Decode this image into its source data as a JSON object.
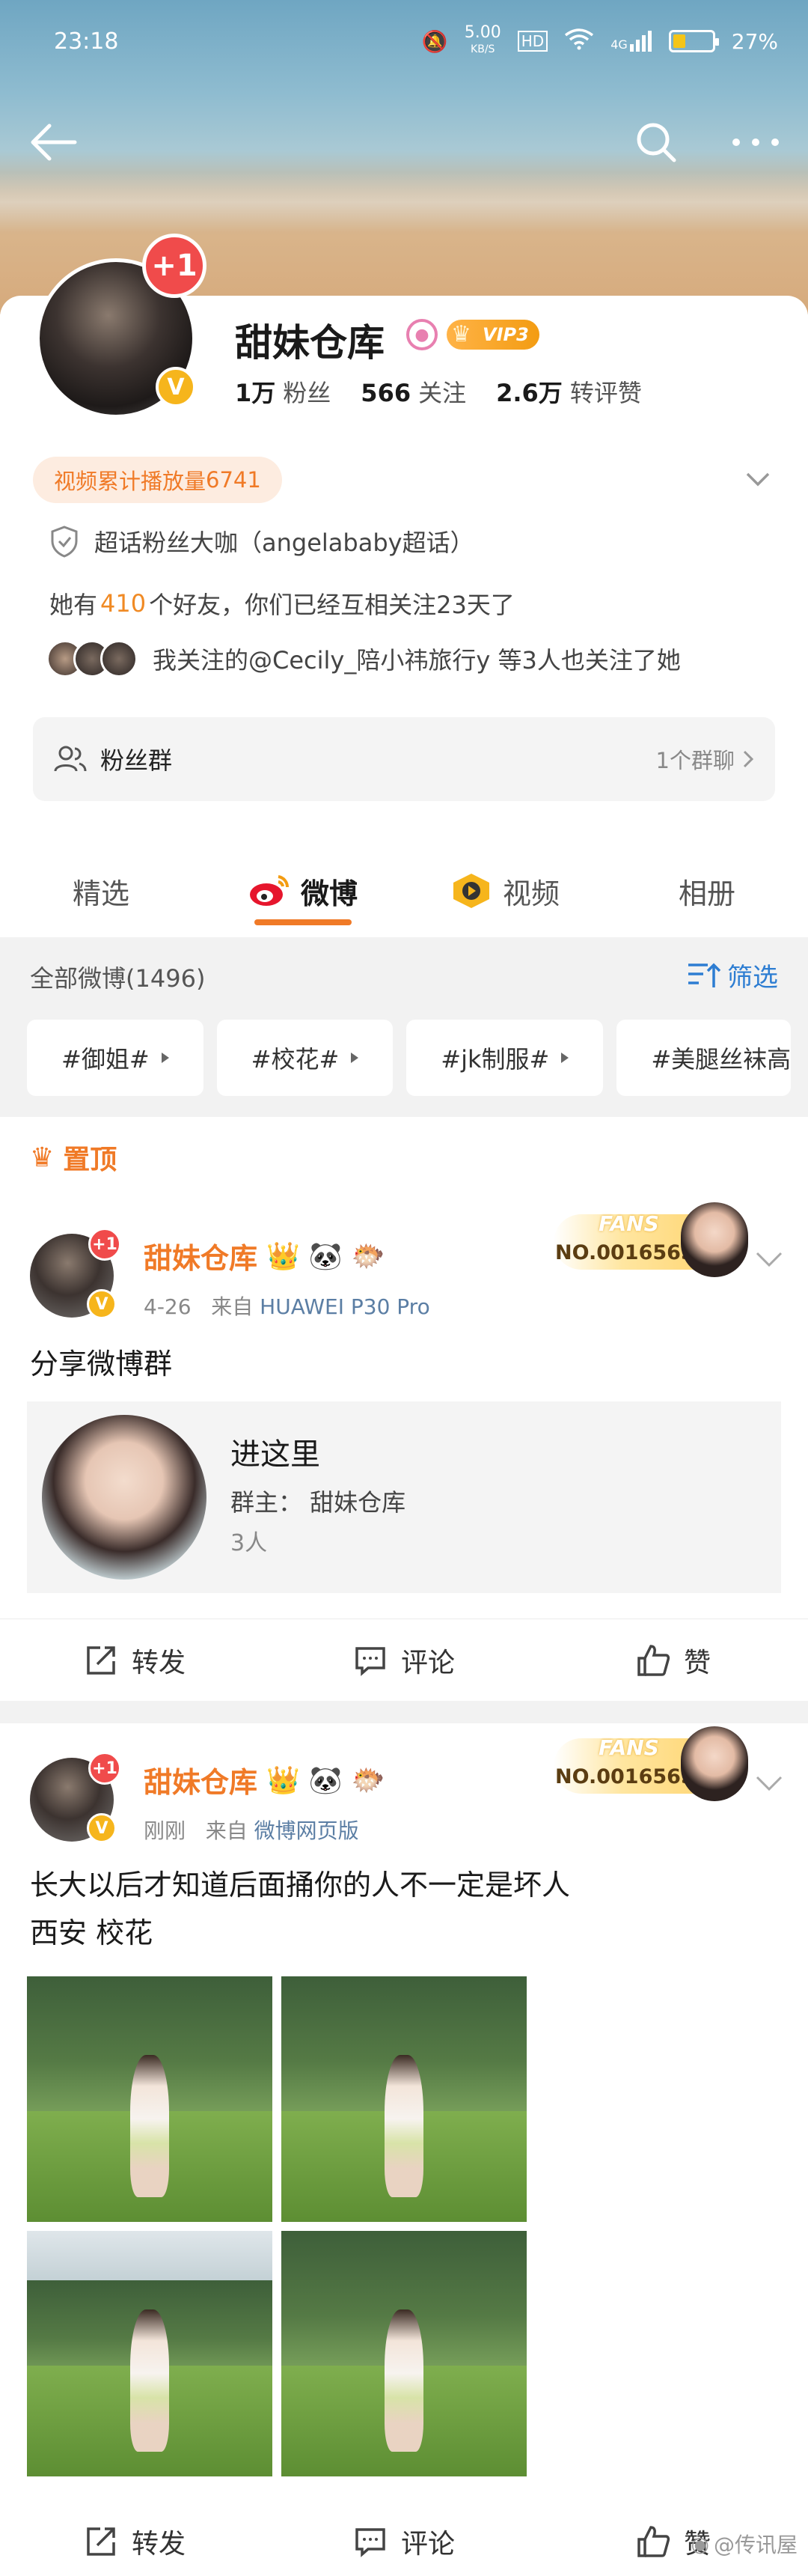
{
  "status_bar": {
    "time": "23:18",
    "net_speed": "5.00",
    "net_unit": "KB/S",
    "hd": "HD",
    "signal": "4G",
    "battery": "27%"
  },
  "profile": {
    "name": "甜妹仓库",
    "plus_badge": "+1",
    "vip_label": "VIP3",
    "stats": {
      "fans_value": "1万",
      "fans_label": "粉丝",
      "follow_value": "566",
      "follow_label": "关注",
      "repost_value": "2.6万",
      "repost_label": "转评赞"
    },
    "video_tag_prefix": "视频累计播放量",
    "video_tag_value": "6741",
    "super_fan": "超话粉丝大咖（angelababy超话）",
    "friends_prefix": "她有",
    "friends_count": "410",
    "friends_suffix": "个好友，你们已经互相关注23天了",
    "mutual_follow": "我关注的@Cecily_陪小祎旅行y 等3人也关注了她",
    "fans_group_label": "粉丝群",
    "fans_group_count": "1个群聊"
  },
  "tabs": [
    {
      "label": "精选"
    },
    {
      "label": "微博"
    },
    {
      "label": "视频"
    },
    {
      "label": "相册"
    }
  ],
  "filter": {
    "all_posts_label": "全部微博",
    "all_posts_count": "(1496)",
    "filter_button": "筛选",
    "chips": [
      "#御姐#",
      "#校花#",
      "#jk制服#",
      "#美腿丝袜高"
    ]
  },
  "pinned_label": "置顶",
  "posts": [
    {
      "name": "甜妹仓库",
      "plus_badge": "+1",
      "date": "4-26",
      "source_prefix": "来自",
      "source": "HUAWEI P30 Pro",
      "fans_title": "FANS",
      "fans_no": "NO.0016565",
      "text": "分享微博群",
      "group_title": "进这里",
      "group_owner": "群主：  甜妹仓库",
      "group_members": "3人",
      "actions": {
        "repost": "转发",
        "comment": "评论",
        "like": "赞"
      }
    },
    {
      "name": "甜妹仓库",
      "plus_badge": "+1",
      "date": "刚刚",
      "source_prefix": "来自",
      "source": "微博网页版",
      "fans_title": "FANS",
      "fans_no": "NO.0016565",
      "text_line1": "长大以后才知道后面捅你的人不一定是坏人",
      "text_line2": "西安 校花",
      "actions": {
        "repost": "转发",
        "comment": "评论",
        "like": "赞"
      }
    }
  ],
  "watermark": "@传讯屋",
  "colors": {
    "accent": "#f07a27",
    "link": "#2d7dd2",
    "badge_red": "#f04b4b",
    "vip_gold": "#f6b51c"
  }
}
